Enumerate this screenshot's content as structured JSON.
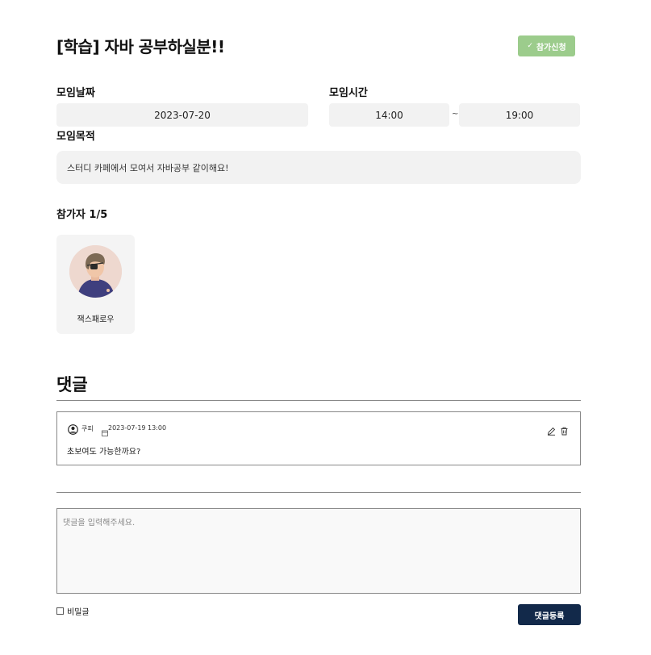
{
  "post": {
    "title": "[학습] 자바 공부하실분!!",
    "join_button": "참가신청"
  },
  "meeting": {
    "date_label": "모임날짜",
    "date_value": "2023-07-20",
    "time_label": "모임시간",
    "time_start": "14:00",
    "time_separator": "~",
    "time_end": "19:00",
    "purpose_label": "모임목적",
    "purpose_value": "스터디 카페에서 모여서 자바공부 같이해요!"
  },
  "participants": {
    "heading": "참가자 1/5",
    "members": [
      {
        "name": "잭스패로우"
      }
    ]
  },
  "comments": {
    "heading": "댓글",
    "items": [
      {
        "author": "쿠피",
        "date": "2023-07-19 13:00",
        "text": "초보여도 가능한까요?"
      }
    ],
    "input_placeholder": "댓글을 입력해주세요.",
    "secret_label": "비밀글",
    "submit_button": "댓글등록"
  },
  "colors": {
    "join_button": "#9ccc8c",
    "submit_button": "#12294a",
    "field_bg": "#f2f2f2"
  },
  "icons": [
    "check-icon",
    "user-icon",
    "calendar-icon",
    "edit-icon",
    "trash-icon"
  ]
}
